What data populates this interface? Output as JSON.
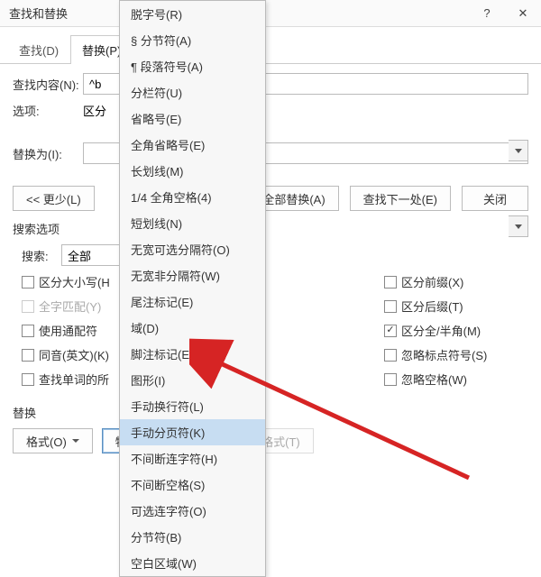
{
  "titlebar": {
    "title": "查找和替换"
  },
  "tabs": {
    "find": "查找(D)",
    "replace": "替换(P)"
  },
  "fields": {
    "find_label": "查找内容(N):",
    "find_value": "^b",
    "options_label": "选项:",
    "options_value": "区分",
    "replace_label": "替换为(I):",
    "replace_value": ""
  },
  "buttons": {
    "less": "<< 更少(L)",
    "replace_all": "全部替换(A)",
    "find_next": "查找下一处(E)",
    "close": "关闭"
  },
  "search_options": {
    "header": "搜索选项",
    "direction_label": "搜索:",
    "direction_value": "全部",
    "left": [
      {
        "key": "matchcase",
        "label": "区分大小写(H",
        "checked": false,
        "disabled": false
      },
      {
        "key": "wholeword",
        "label": "全字匹配(Y)",
        "checked": false,
        "disabled": true
      },
      {
        "key": "wildcards",
        "label": "使用通配符",
        "checked": false,
        "disabled": false
      },
      {
        "key": "soundslike",
        "label": "同音(英文)(K)",
        "checked": false,
        "disabled": false
      },
      {
        "key": "allforms",
        "label": "查找单词的所",
        "checked": false,
        "disabled": false
      }
    ],
    "right": [
      {
        "key": "prefix",
        "label": "区分前缀(X)",
        "checked": false
      },
      {
        "key": "suffix",
        "label": "区分后缀(T)",
        "checked": false
      },
      {
        "key": "fullhalf",
        "label": "区分全/半角(M)",
        "checked": true
      },
      {
        "key": "ignorepunct",
        "label": "忽略标点符号(S)",
        "checked": false
      },
      {
        "key": "ignorespace",
        "label": "忽略空格(W)",
        "checked": false
      }
    ]
  },
  "footer": {
    "label": "替换",
    "format": "格式(O)",
    "special": "特殊格式(E)",
    "noformat": "不限定格式(T)"
  },
  "menu": {
    "items": [
      "脱字号(R)",
      "§ 分节符(A)",
      "¶ 段落符号(A)",
      "分栏符(U)",
      "省略号(E)",
      "全角省略号(E)",
      "长划线(M)",
      "1/4 全角空格(4)",
      "短划线(N)",
      "无宽可选分隔符(O)",
      "无宽非分隔符(W)",
      "尾注标记(E)",
      "域(D)",
      "脚注标记(E)",
      "图形(I)",
      "手动换行符(L)",
      "手动分页符(K)",
      "不间断连字符(H)",
      "不间断空格(S)",
      "可选连字符(O)",
      "分节符(B)",
      "空白区域(W)"
    ],
    "hover_index": 16
  }
}
